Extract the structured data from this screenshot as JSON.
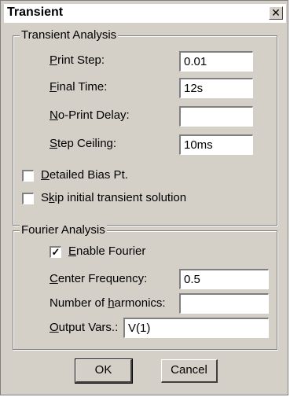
{
  "window": {
    "title": "Transient",
    "close_glyph": "✕"
  },
  "transient_group": {
    "legend": "Transient Analysis",
    "print_step": {
      "label_mnemonic": "P",
      "label_rest": "rint Step:",
      "value": "0.01"
    },
    "final_time": {
      "label_mnemonic": "F",
      "label_rest": "inal Time:",
      "value": "12s"
    },
    "no_print_delay": {
      "label_mnemonic": "N",
      "label_rest": "o-Print Delay:",
      "value": ""
    },
    "step_ceiling": {
      "label_mnemonic": "S",
      "label_rest": "tep Ceiling:",
      "value": "10ms"
    },
    "detailed_bias": {
      "label_mnemonic": "D",
      "label_rest": "etailed Bias Pt.",
      "checked": false
    },
    "skip_initial": {
      "label_pre": "S",
      "label_mnemonic": "k",
      "label_rest": "ip initial transient solution",
      "checked": false
    }
  },
  "fourier_group": {
    "legend": "Fourier Analysis",
    "enable_fourier": {
      "label_mnemonic": "E",
      "label_rest": "nable Fourier",
      "checked": true,
      "check_glyph": "✓"
    },
    "center_frequency": {
      "label_mnemonic": "C",
      "label_rest": "enter Frequency:",
      "value": "0.5"
    },
    "num_harmonics": {
      "label_pre": "Number of ",
      "label_mnemonic": "h",
      "label_rest": "armonics:",
      "value": ""
    },
    "output_vars": {
      "label_mnemonic": "O",
      "label_rest": "utput Vars.:",
      "value": "V(1)"
    }
  },
  "buttons": {
    "ok": "OK",
    "cancel": "Cancel"
  }
}
